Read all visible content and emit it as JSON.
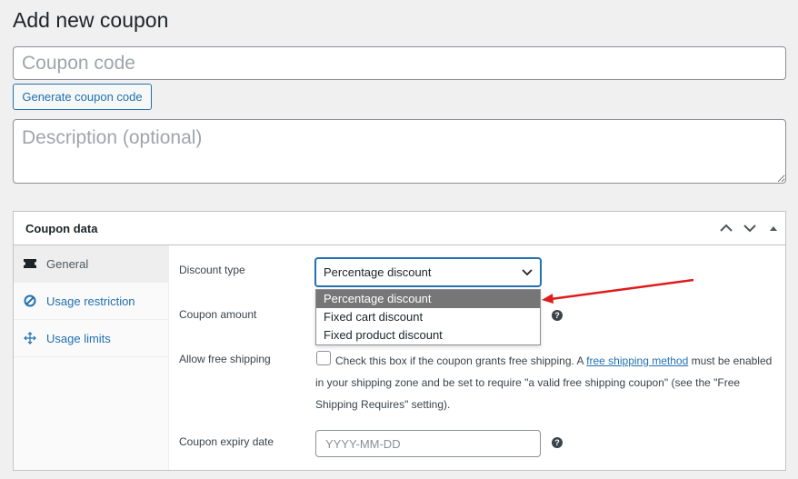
{
  "page": {
    "title": "Add new coupon"
  },
  "coupon": {
    "code_placeholder": "Coupon code",
    "generate_label": "Generate coupon code",
    "description_placeholder": "Description (optional)"
  },
  "panel": {
    "title": "Coupon data",
    "header_icons": [
      "chevron-up-icon",
      "chevron-down-icon",
      "triangle-up-icon"
    ],
    "tabs": [
      {
        "label": "General",
        "icon": "ticket-icon",
        "active": true
      },
      {
        "label": "Usage restriction",
        "icon": "block-icon",
        "active": false
      },
      {
        "label": "Usage limits",
        "icon": "arrows-icon",
        "active": false
      }
    ]
  },
  "fields": {
    "discount_type_label": "Discount type",
    "discount_type_value": "Percentage discount",
    "discount_options": [
      "Percentage discount",
      "Fixed cart discount",
      "Fixed product discount"
    ],
    "coupon_amount_label": "Coupon amount",
    "free_shipping_label": "Allow free shipping",
    "free_shipping_text_before": "Check this box if the coupon grants free shipping. A ",
    "free_shipping_link": "free shipping method",
    "free_shipping_text_after": " must be enabled in your shipping zone and be set to require \"a valid free shipping coupon\" (see the \"Free Shipping Requires\" setting).",
    "expiry_label": "Coupon expiry date",
    "expiry_placeholder": "YYYY-MM-DD",
    "help_glyph": "?"
  },
  "colors": {
    "accent": "#2271b1",
    "annotation_arrow": "#e01b1b",
    "selected_option_bg": "#767676"
  }
}
